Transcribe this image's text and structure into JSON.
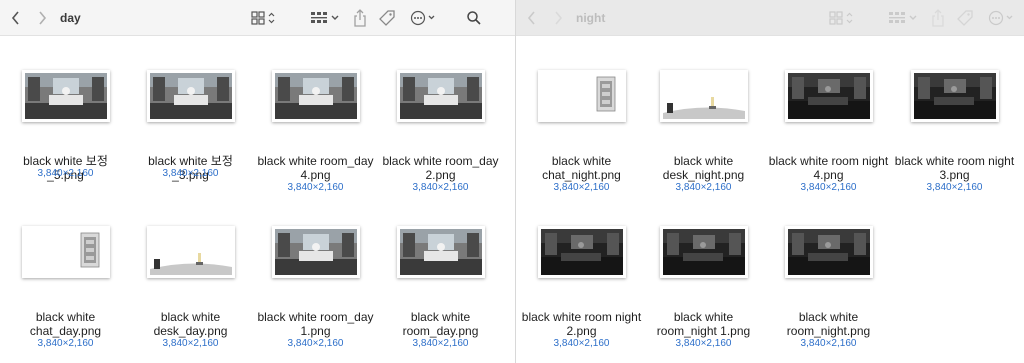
{
  "left_window": {
    "title": "day",
    "items": [
      {
        "name": "black white 보정_5.png",
        "dims": "3,840×2,160",
        "thumb": "room"
      },
      {
        "name": "black white 보정_3.png",
        "dims": "3,840×2,160",
        "thumb": "room"
      },
      {
        "name": "black white room_day 4.png",
        "dims": "3,840×2,160",
        "thumb": "room"
      },
      {
        "name": "black white room_day 2.png",
        "dims": "3,840×2,160",
        "thumb": "room"
      },
      {
        "name": "black white chat_day.png",
        "dims": "3,840×2,160",
        "thumb": "chat"
      },
      {
        "name": "black white desk_day.png",
        "dims": "3,840×2,160",
        "thumb": "desk"
      },
      {
        "name": "black white room_day 1.png",
        "dims": "3,840×2,160",
        "thumb": "room"
      },
      {
        "name": "black white room_day.png",
        "dims": "3,840×2,160",
        "thumb": "room"
      }
    ]
  },
  "right_window": {
    "title": "night",
    "items": [
      {
        "name": "black white chat_night.png",
        "dims": "3,840×2,160",
        "thumb": "chat"
      },
      {
        "name": "black white desk_night.png",
        "dims": "3,840×2,160",
        "thumb": "desk"
      },
      {
        "name": "black white room night 4.png",
        "dims": "3,840×2,160",
        "thumb": "room-night"
      },
      {
        "name": "black white room night 3.png",
        "dims": "3,840×2,160",
        "thumb": "room-night"
      },
      {
        "name": "black white room night 2.png",
        "dims": "3,840×2,160",
        "thumb": "room-night"
      },
      {
        "name": "black white room_night 1.png",
        "dims": "3,840×2,160",
        "thumb": "room-night"
      },
      {
        "name": "black white room_night.png",
        "dims": "3,840×2,160",
        "thumb": "room-night"
      }
    ]
  },
  "toolbar_icons": [
    "back-icon",
    "forward-icon",
    "icon-view-icon",
    "group-by-icon",
    "share-icon",
    "tag-icon",
    "more-icon",
    "search-icon"
  ],
  "colors": {
    "dims_text": "#2d6fc9",
    "toolbar_active": "#f5f5f5",
    "toolbar_inactive": "#e9e9e9"
  }
}
